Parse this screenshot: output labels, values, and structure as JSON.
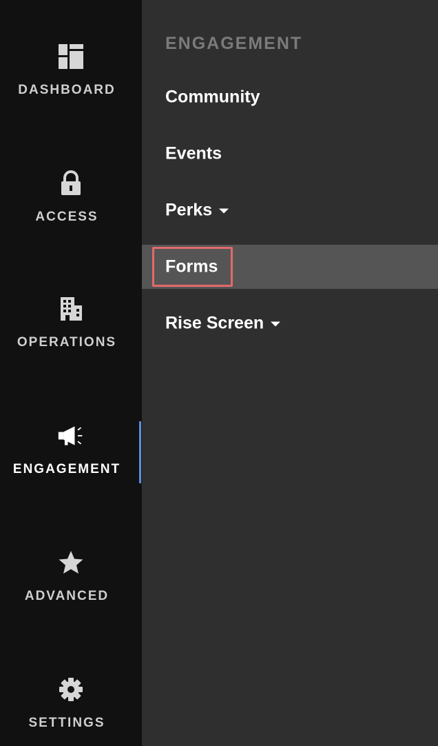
{
  "rail": {
    "items": [
      {
        "label": "DASHBOARD",
        "icon": "dashboard-icon"
      },
      {
        "label": "ACCESS",
        "icon": "lock-icon"
      },
      {
        "label": "OPERATIONS",
        "icon": "building-icon"
      },
      {
        "label": "ENGAGEMENT",
        "icon": "megaphone-icon",
        "active": true
      },
      {
        "label": "ADVANCED",
        "icon": "star-icon"
      },
      {
        "label": "SETTINGS",
        "icon": "gear-icon"
      }
    ],
    "accent_color": "#5b8ede"
  },
  "panel": {
    "title": "ENGAGEMENT",
    "items": [
      {
        "label": "Community",
        "has_dropdown": false
      },
      {
        "label": "Events",
        "has_dropdown": false
      },
      {
        "label": "Perks",
        "has_dropdown": true
      },
      {
        "label": "Forms",
        "has_dropdown": false,
        "selected": true
      },
      {
        "label": "Rise Screen",
        "has_dropdown": true
      }
    ],
    "highlight_color": "#e46a6a"
  }
}
